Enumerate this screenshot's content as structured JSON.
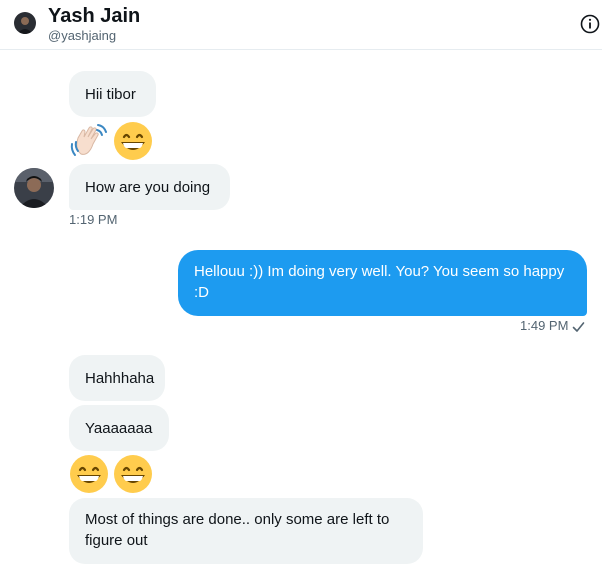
{
  "header": {
    "name": "Yash Jain",
    "handle": "@yashjaing",
    "info_icon": "info-circle-icon"
  },
  "messages": {
    "m1": "Hii tibor",
    "m2_emojis": [
      "waving-hand-emoji",
      "grinning-face-emoji"
    ],
    "m3": "How are you doing",
    "m3_time": "1:19 PM",
    "m4": "Hellouu :)) Im doing very well. You? You seem so happy :D",
    "m4_time": "1:49 PM",
    "m5": "Hahhhaha",
    "m6": "Yaaaaaaa",
    "m7_emojis": [
      "grinning-face-emoji",
      "grinning-face-emoji"
    ],
    "m8": "Most of things are done.. only some are left to figure out"
  },
  "colors": {
    "outgoing_bubble": "#1d9bf0",
    "incoming_bubble": "#eff3f4",
    "muted_text": "#536471"
  }
}
